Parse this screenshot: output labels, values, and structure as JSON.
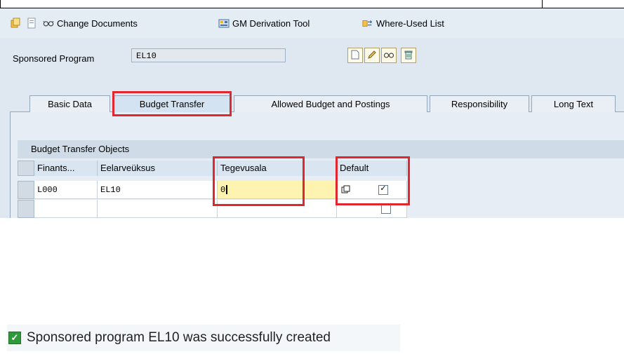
{
  "toolbar": {
    "items": [
      {
        "icon": "copy-multi-icon",
        "label": ""
      },
      {
        "icon": "document-icon",
        "label": ""
      },
      {
        "icon": "glasses-icon",
        "label": "Change Documents"
      },
      {
        "icon": "derivation-tool-icon",
        "label": "GM Derivation Tool"
      },
      {
        "icon": "where-used-icon",
        "label": "Where-Used List"
      }
    ]
  },
  "header": {
    "sponsored_program_label": "Sponsored Program",
    "sponsored_program_value": "EL10"
  },
  "tabs": [
    {
      "label": "Basic Data"
    },
    {
      "label": "Budget Transfer",
      "active": true
    },
    {
      "label": "Allowed Budget and Postings"
    },
    {
      "label": "Responsibility"
    },
    {
      "label": "Long Text"
    }
  ],
  "table": {
    "title": "Budget Transfer Objects",
    "columns": [
      "Finants...",
      "Eelarveüksus",
      "Tegevusala",
      "Default"
    ],
    "rows": [
      {
        "c1": "L000",
        "c2": "EL10",
        "c3": "0",
        "default_checked": true
      },
      {
        "c1": "",
        "c2": "",
        "c3": "",
        "default_checked": false
      }
    ]
  },
  "status": {
    "text": "Sponsored program EL10 was successfully created",
    "color": "#2f9a3a"
  }
}
